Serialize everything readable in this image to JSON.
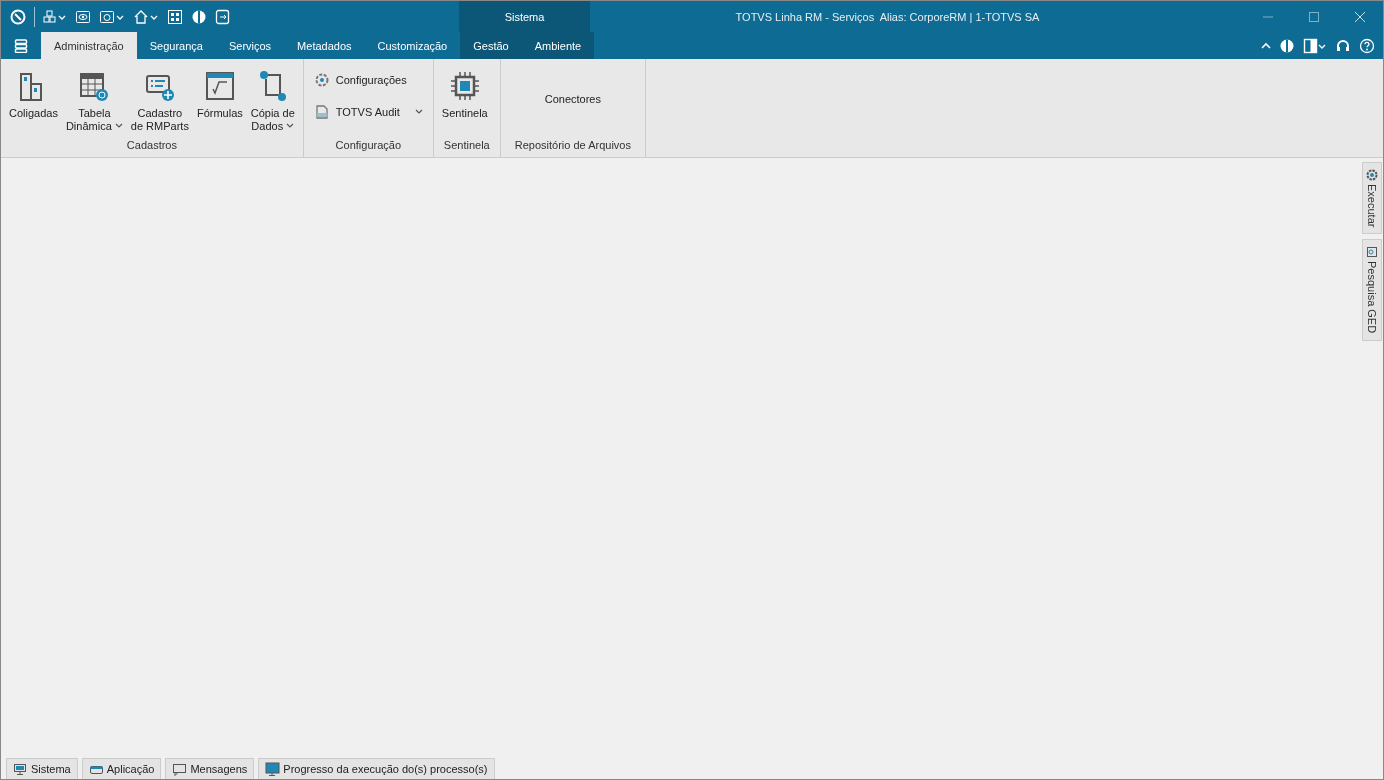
{
  "window": {
    "title": "TOTVS Linha RM - Serviços  Alias: CorporeRM | 1-TOTVS SA"
  },
  "context_group": {
    "label": "Sistema"
  },
  "tabs": [
    {
      "label": "Administração",
      "selected": true,
      "contextual": false
    },
    {
      "label": "Segurança",
      "selected": false,
      "contextual": false
    },
    {
      "label": "Serviços",
      "selected": false,
      "contextual": false
    },
    {
      "label": "Metadados",
      "selected": false,
      "contextual": false
    },
    {
      "label": "Customização",
      "selected": false,
      "contextual": false
    },
    {
      "label": "Gestão",
      "selected": false,
      "contextual": true
    },
    {
      "label": "Ambiente",
      "selected": false,
      "contextual": true
    }
  ],
  "ribbon_groups": [
    {
      "label": "Cadastros",
      "items": [
        {
          "kind": "large",
          "lines": [
            "Coligadas"
          ],
          "dropdown": false
        },
        {
          "kind": "large",
          "lines": [
            "Tabela",
            "Dinâmica"
          ],
          "dropdown": true
        },
        {
          "kind": "large",
          "lines": [
            "Cadastro",
            "de RMParts"
          ],
          "dropdown": false
        },
        {
          "kind": "large",
          "lines": [
            "Fórmulas"
          ],
          "dropdown": false
        },
        {
          "kind": "large",
          "lines": [
            "Cópia de",
            "Dados"
          ],
          "dropdown": true
        }
      ]
    },
    {
      "label": "Configuração",
      "items": [
        {
          "kind": "small",
          "lines": [
            "Configurações"
          ],
          "dropdown": false
        },
        {
          "kind": "small",
          "lines": [
            "TOTVS Audit"
          ],
          "dropdown": true
        }
      ]
    },
    {
      "label": "Sentinela",
      "items": [
        {
          "kind": "large",
          "lines": [
            "Sentinela"
          ],
          "dropdown": false
        }
      ]
    },
    {
      "label": "Repositório de Arquivos",
      "items": [
        {
          "kind": "text",
          "lines": [
            "Conectores"
          ]
        }
      ]
    }
  ],
  "side_panels": [
    "Executar",
    "Pesquisa GED"
  ],
  "bottom_tabs": [
    "Sistema",
    "Aplicação",
    "Mensagens",
    "Progresso da execução do(s) processo(s)"
  ]
}
